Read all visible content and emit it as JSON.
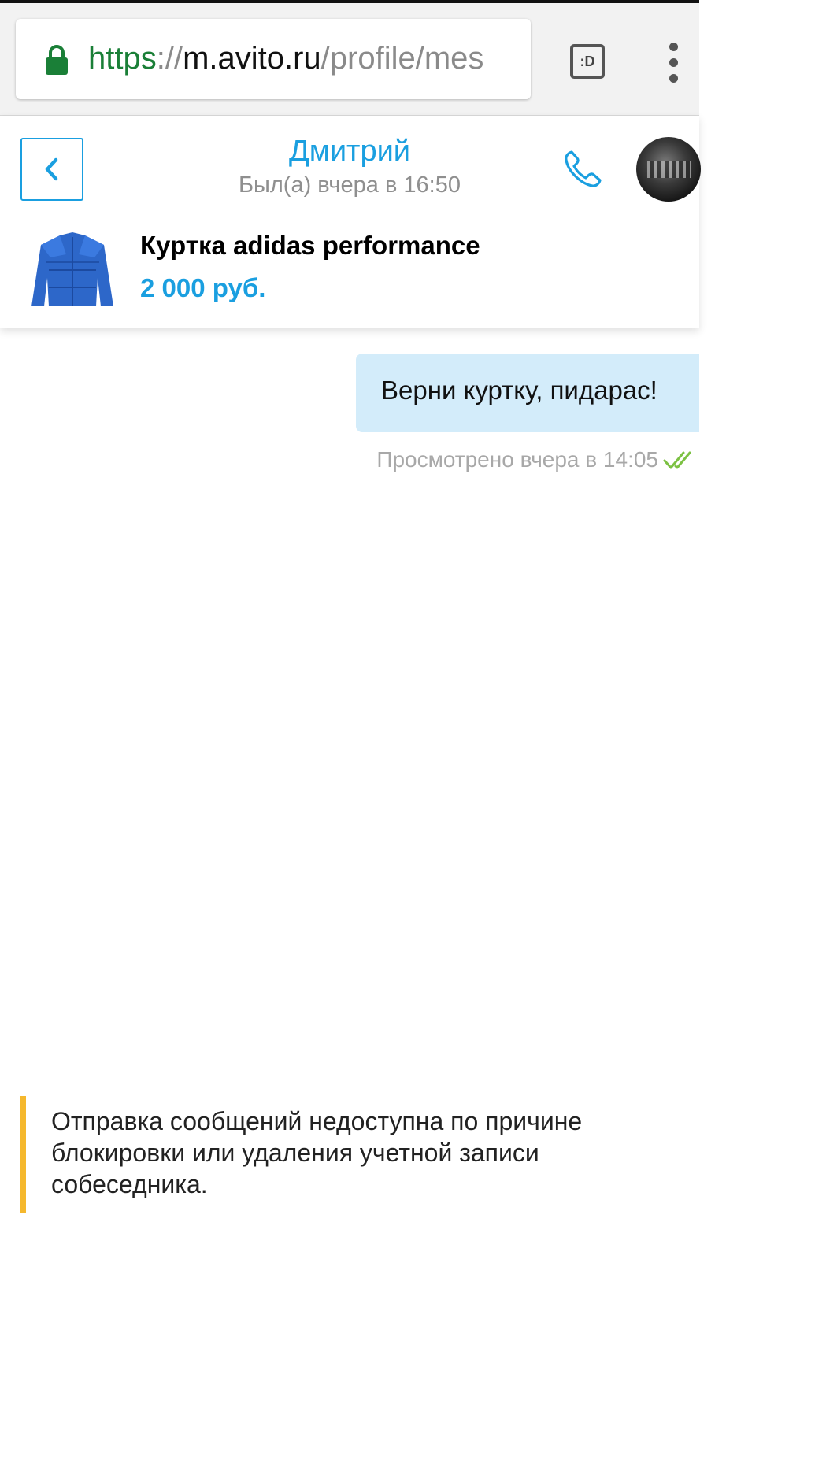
{
  "browser": {
    "url_scheme": "https",
    "url_sep": "://",
    "url_host": "m.avito.ru",
    "url_path": "/profile/mes",
    "reader_label": ":D",
    "icons": [
      "lock-icon",
      "reader-mode-icon",
      "menu-dots-icon"
    ]
  },
  "chat": {
    "contact_name": "Дмитрий",
    "contact_status": "Был(а) вчера в 16:50",
    "item_title": "Куртка adidas performance",
    "item_price": "2 000 руб.",
    "icons": [
      "back-arrow-icon",
      "phone-icon",
      "avatar"
    ]
  },
  "messages": [
    {
      "text": "Верни куртку, пидарас!",
      "status": "Просмотрено вчера в 14:05",
      "direction": "outgoing"
    }
  ],
  "notice": {
    "text": "Отправка сообщений недоступна по причине блокировки или удаления учетной записи собеседника."
  },
  "colors": {
    "accent": "#1a9fe0",
    "bubble": "#d3ecfa",
    "notice_bar": "#f5b82e",
    "seen_check": "#7cc143",
    "secure_green": "#1a7f37"
  }
}
